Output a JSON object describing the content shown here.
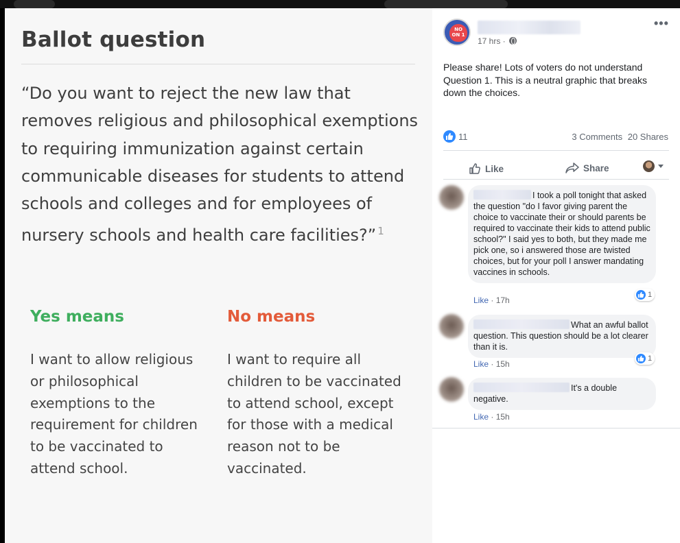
{
  "image": {
    "title": "Ballot question",
    "question_text": "“Do you want to reject the new law that removes religious and philosophical exemptions to requiring immunization against certain communicable diseases for students to attend schools and colleges and for employees of nursery schools and health care facilities?”",
    "footnote": "1",
    "yes_heading": "Yes means",
    "yes_text": "I want to allow religious or philosophical exemptions to the requirement for children to be vaccinated to attend school.",
    "no_heading": "No means",
    "no_text": "I want to require all children to be vaccinated to attend school, except for those with a medical reason not to be vaccinated.",
    "colors": {
      "yes": "#3fae5e",
      "no": "#e35b3a"
    }
  },
  "post": {
    "avatar_text": "NO ON 1",
    "time": "17 hrs ·",
    "more_icon": "more-dots-icon",
    "text": "Please share! Lots of voters do not understand Question 1. This is a neutral graphic that breaks down the choices.",
    "reactions_count": "11",
    "comments_count": "3 Comments",
    "shares_count": "20 Shares",
    "actions": {
      "like": "Like",
      "share": "Share"
    }
  },
  "comments": [
    {
      "text": "I took a poll tonight that asked the question \"do I favor giving parent the choice to vaccinate their or should parents be required to vaccinate their kids to attend public school?\" I said yes to both, but they made me pick one, so i answered those are twisted choices, but for your poll I answer mandating vaccines in schools.",
      "like_label": "Like",
      "time": "17h",
      "reactions": "1"
    },
    {
      "text": "What an awful ballot question. This question should be a lot clearer than it is.",
      "like_label": "Like",
      "time": "15h",
      "reactions": "1"
    },
    {
      "text": "It's a double negative.",
      "like_label": "Like",
      "time": "15h"
    }
  ]
}
